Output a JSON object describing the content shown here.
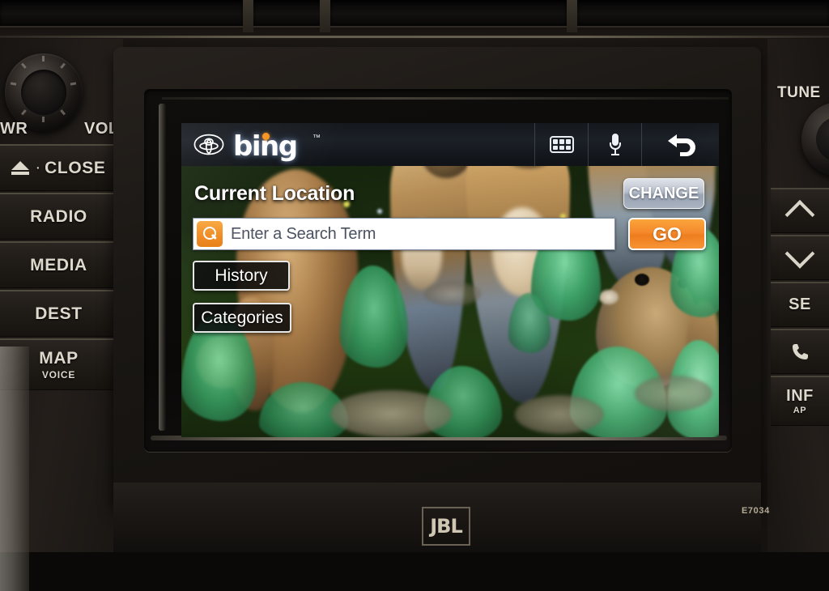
{
  "device": {
    "brand_badge": "JBL",
    "model_code": "E7034",
    "toyota_emblem": "toyota-emblem"
  },
  "left_controls": {
    "knob_label_left": "WR",
    "knob_label_right": "VOL",
    "eject_label": "CLOSE",
    "buttons": [
      {
        "label": "RADIO",
        "sub": ""
      },
      {
        "label": "MEDIA",
        "sub": ""
      },
      {
        "label": "DEST",
        "sub": ""
      },
      {
        "label": "MAP",
        "sub": "VOICE"
      }
    ]
  },
  "right_controls": {
    "knob_label": "TUNE",
    "buttons": [
      {
        "label": "",
        "icon": "chevron-up-icon"
      },
      {
        "label": "",
        "icon": "chevron-down-icon"
      },
      {
        "label": "SE",
        "icon": ""
      },
      {
        "label": "",
        "icon": "phone-icon"
      },
      {
        "label": "INF",
        "sub": "AP"
      }
    ]
  },
  "screen": {
    "header": {
      "logo_text": "bing",
      "trademark": "™",
      "dot_color": "#f59320",
      "icons": [
        {
          "name": "apps-grid-icon",
          "label": "apps"
        },
        {
          "name": "microphone-icon",
          "label": "voice"
        },
        {
          "name": "back-arrow-icon",
          "label": "back"
        }
      ]
    },
    "location": {
      "label": "Current Location",
      "change_button": "CHANGE"
    },
    "search": {
      "placeholder": "Enter a Search Term",
      "value": "",
      "go_button": "GO",
      "icon": "search-icon",
      "icon_color": "#f08a20"
    },
    "side_buttons": [
      {
        "label": "History",
        "name": "history-button"
      },
      {
        "label": "Categories",
        "name": "categories-button"
      }
    ],
    "background": {
      "description": "photo of prairie dogs standing in green grass",
      "accent_green": "#1d3311"
    }
  }
}
